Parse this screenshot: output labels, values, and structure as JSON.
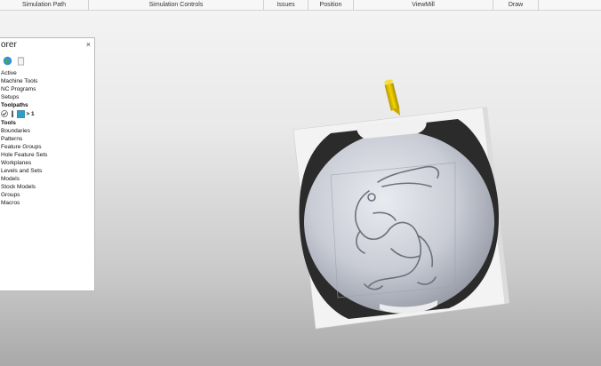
{
  "ribbon": {
    "groups": [
      {
        "label": "Simulation Path"
      },
      {
        "label": "Simulation Controls"
      },
      {
        "label": "Issues"
      },
      {
        "label": "Position"
      },
      {
        "label": "ViewMill"
      },
      {
        "label": "Draw"
      }
    ]
  },
  "explorer": {
    "title": "orer",
    "close_glyph": "×",
    "toolbar": [
      {
        "icon": "globe-icon"
      },
      {
        "icon": "clipboard-icon"
      }
    ],
    "items": [
      {
        "label": "Active"
      },
      {
        "label": "Machine Tools"
      },
      {
        "label": "NC Programs"
      },
      {
        "label": "Setups"
      },
      {
        "label": "Toolpaths"
      },
      {
        "label": "> 1"
      },
      {
        "label": "Tools"
      },
      {
        "label": "Boundaries"
      },
      {
        "label": "Patterns"
      },
      {
        "label": "Feature Groups"
      },
      {
        "label": "Hole Feature Sets"
      },
      {
        "label": "Workplanes"
      },
      {
        "label": "Levels and Sets"
      },
      {
        "label": "Models"
      },
      {
        "label": "Stock Models"
      },
      {
        "label": "Groups"
      },
      {
        "label": "Macros"
      }
    ]
  },
  "colors": {
    "tool_yellow": "#e8c400",
    "stock_white": "#f2f2f2",
    "relief_gray": "#c7cad3",
    "rim_dark": "#2a2a2a"
  }
}
